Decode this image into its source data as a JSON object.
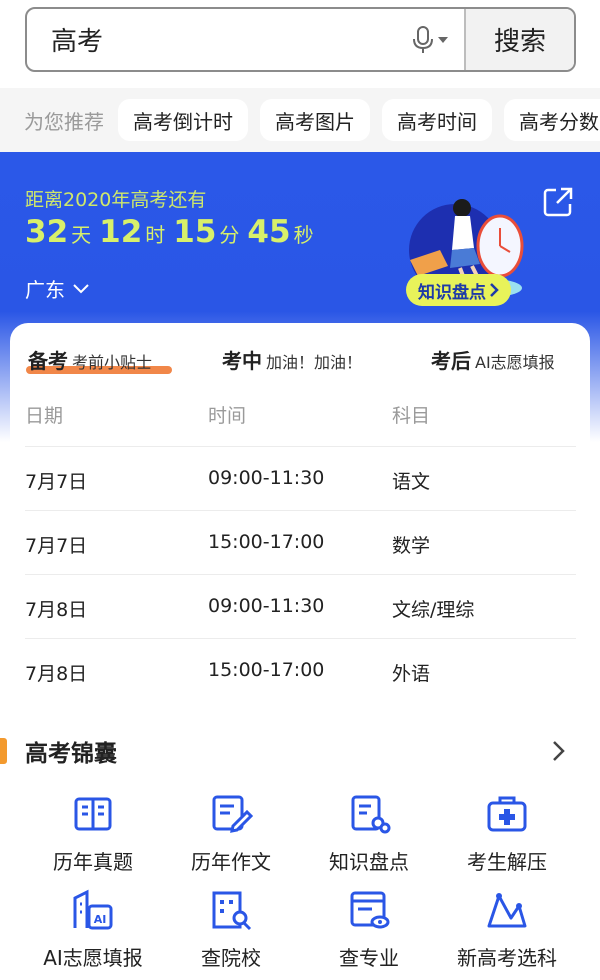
{
  "search": {
    "query": "高考",
    "button_label": "搜索"
  },
  "suggestions": {
    "label": "为您推荐",
    "chips": [
      "高考倒计时",
      "高考图片",
      "高考时间",
      "高考分数"
    ]
  },
  "banner": {
    "title": "距离2020年高考还有",
    "days": "32",
    "days_unit": "天",
    "hours": "12",
    "hours_unit": "时",
    "minutes": "15",
    "minutes_unit": "分",
    "seconds": "45",
    "seconds_unit": "秒",
    "region": "广东",
    "knowledge_button": "知识盘点"
  },
  "tabs": [
    {
      "main": "备考",
      "sub": "考前小贴士"
    },
    {
      "main": "考中",
      "sub": "加油！加油！"
    },
    {
      "main": "考后",
      "sub": "AI志愿填报"
    }
  ],
  "schedule": {
    "headers": [
      "日期",
      "时间",
      "科目"
    ],
    "rows": [
      [
        "7月7日",
        "09:00-11:30",
        "语文"
      ],
      [
        "7月7日",
        "15:00-17:00",
        "数学"
      ],
      [
        "7月8日",
        "09:00-11:30",
        "文综/理综"
      ],
      [
        "7月8日",
        "15:00-17:00",
        "外语"
      ]
    ]
  },
  "toolkit": {
    "title": "高考锦囊",
    "items": [
      {
        "label": "历年真题",
        "icon": "exam-paper-icon"
      },
      {
        "label": "历年作文",
        "icon": "essay-edit-icon"
      },
      {
        "label": "知识盘点",
        "icon": "knowledge-review-icon"
      },
      {
        "label": "考生解压",
        "icon": "first-aid-kit-icon"
      },
      {
        "label": "AI志愿填报",
        "icon": "ai-building-icon"
      },
      {
        "label": "查院校",
        "icon": "school-search-icon"
      },
      {
        "label": "查专业",
        "icon": "major-view-icon"
      },
      {
        "label": "新高考选科",
        "icon": "subject-chart-icon"
      }
    ]
  },
  "colors": {
    "accent_blue": "#2a56e6",
    "countdown_yellow": "#d8f06a",
    "underline_orange": "#f07a35"
  }
}
